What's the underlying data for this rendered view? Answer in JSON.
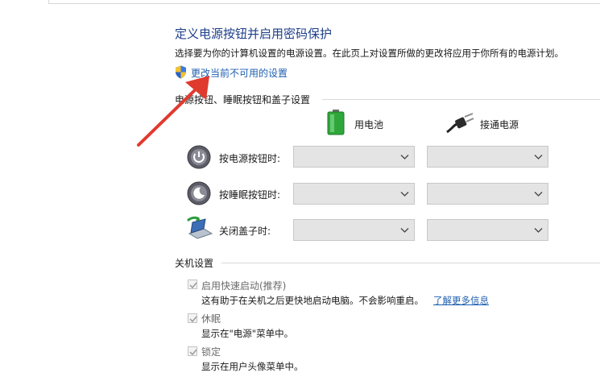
{
  "page": {
    "title": "定义电源按钮并启用密码保护",
    "description": "选择要为你的计算机设置的电源设置。在此页上对设置所做的更改将应用于你所有的电源计划。",
    "change_link": "更改当前不可用的设置"
  },
  "power_section": {
    "heading": "电源按钮、睡眠按钮和盖子设置",
    "columns": {
      "battery": "用电池",
      "plugged": "接通电源"
    },
    "rows": [
      {
        "label": "按电源按钮时:",
        "battery_value": "",
        "plugged_value": ""
      },
      {
        "label": "按睡眠按钮时:",
        "battery_value": "",
        "plugged_value": ""
      },
      {
        "label": "关闭盖子时:",
        "battery_value": "",
        "plugged_value": ""
      }
    ]
  },
  "shutdown_section": {
    "heading": "关机设置",
    "fast_startup": {
      "label": "启用快速启动(推荐)",
      "description": "这有助于在关机之后更快地启动电脑。不会影响重启。",
      "link": "了解更多信息",
      "checked": true
    },
    "hibernate": {
      "label": "休眠",
      "description": "显示在\"电源\"菜单中。",
      "checked": true
    },
    "lock": {
      "label": "锁定",
      "description": "显示在用户头像菜单中。",
      "checked": true
    }
  },
  "colors": {
    "title": "#1e3f8a",
    "link": "#1f5fb0",
    "annotation_arrow": "#e03a2f",
    "dropdown_bg": "#e4e4e4"
  },
  "icons": {
    "shield": "uac-shield-icon",
    "battery": "battery-icon",
    "plug": "power-plug-icon",
    "power_button": "power-button-icon",
    "sleep_button": "sleep-button-icon",
    "lid": "laptop-lid-icon",
    "chevron": "chevron-down-icon",
    "check": "checkmark-icon"
  }
}
